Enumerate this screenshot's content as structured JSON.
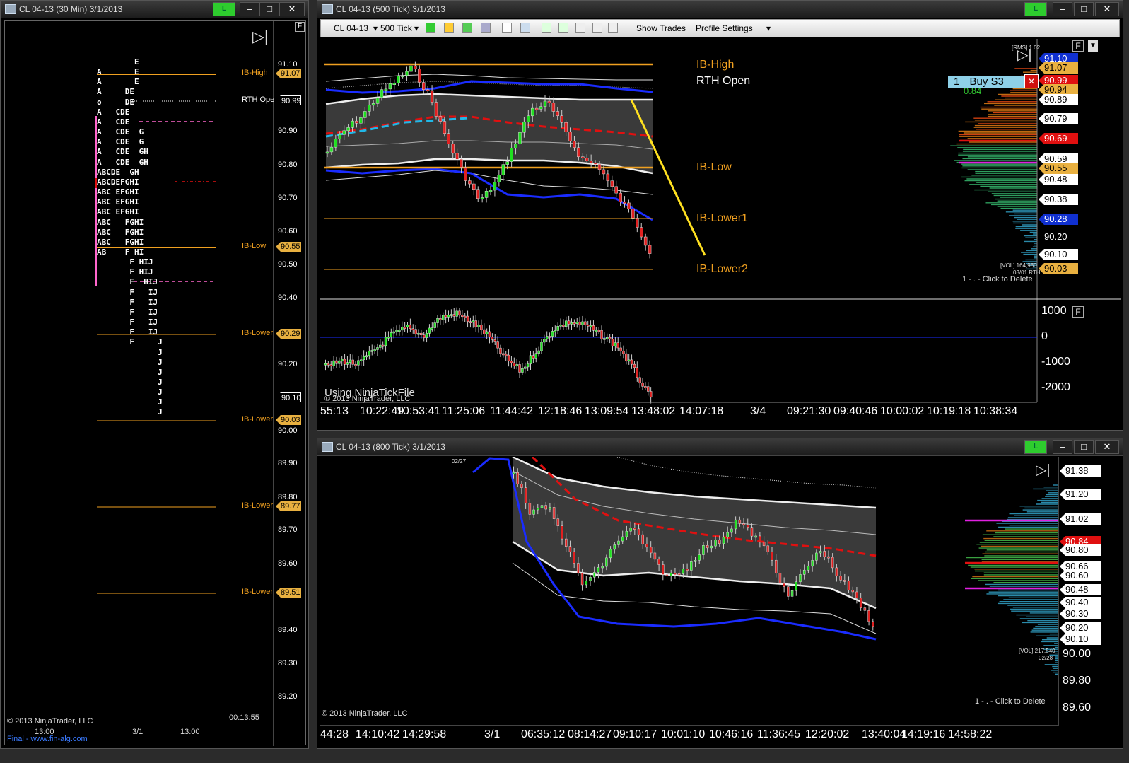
{
  "left": {
    "title": "CL 04-13 (30 Min)  3/1/2013",
    "level_labels": [
      {
        "text": "IB-High",
        "tag": "91.07",
        "color": "#f0a020"
      },
      {
        "text": "RTH Ope",
        "tag": "90.99",
        "color": "#ffffff"
      },
      {
        "text": "IB-Low",
        "tag": "90.55",
        "color": "#f0a020"
      },
      {
        "text": "IB-Lower",
        "tag": "90.29",
        "color": "#f0a020"
      },
      {
        "text": "IB-Lower",
        "tag": "90.03",
        "color": "#f0a020"
      },
      {
        "text": "IB-Lower",
        "tag": "89.77",
        "color": "#f0a020"
      },
      {
        "text": "IB-Lower",
        "tag": "89.51",
        "color": "#f0a020"
      }
    ],
    "price_labels": [
      "91.10",
      "90.90",
      "90.80",
      "90.70",
      "90.60",
      "90.50",
      "90.40",
      "90.20",
      "90.00",
      "89.90",
      "89.80",
      "89.70",
      "89.60",
      "89.40",
      "89.30",
      "89.20"
    ],
    "last_price_tag": "90.10",
    "tpo_rows": [
      "        E",
      "A       E",
      "A       E",
      "A     DE",
      "o     DE",
      "A   CDE",
      "A   CDE",
      "A   CDE  G",
      "A   CDE  G",
      "A   CDE  GH",
      "A   CDE  GH",
      "ABCDE  GH",
      "ABCDEFGHI",
      "ABC EFGHI",
      "ABC EFGHI",
      "ABC EFGHI",
      "ABC   FGHI",
      "ABC   FGHI",
      "ABC   FGHI",
      "AB    F HI",
      "       F HIJ",
      "       F HIJ",
      "       F  HIJ",
      "       F   IJ",
      "       F   IJ",
      "       F   IJ",
      "       F   IJ",
      "       F   IJ",
      "       F     J",
      "             J",
      "             J",
      "             J",
      "             J",
      "             J",
      "             J",
      "             J"
    ],
    "time_labels": [
      "13:00",
      "3/1",
      "13:00"
    ],
    "clock": "00:13:55",
    "copyright": "© 2013 NinjaTrader, LLC",
    "footer": "Final - www.fin-alg.com"
  },
  "top": {
    "title": "CL 04-13 (500 Tick)  3/1/2013",
    "toolbar": {
      "instrument": "CL 04-13",
      "interval": "500 Tick",
      "show_trades": "Show Trades",
      "profile_settings": "Profile Settings"
    },
    "annotations": [
      {
        "text": "IB-High",
        "color": "#f0a020"
      },
      {
        "text": "RTH Open",
        "color": "#ffffff"
      },
      {
        "text": "IB-Low",
        "color": "#f0a020"
      },
      {
        "text": "IB-Lower1",
        "color": "#f0a020"
      },
      {
        "text": "IB-Lower2",
        "color": "#f0a020"
      }
    ],
    "price_tags": [
      {
        "v": "91.10",
        "bg": "#1030d0",
        "fg": "#ffffff"
      },
      {
        "v": "91.07",
        "bg": "#e8b040",
        "fg": "#000000"
      },
      {
        "v": "90.99",
        "bg": "#e01010",
        "fg": "#ffffff"
      },
      {
        "v": "90.94",
        "bg": "#e8b040",
        "fg": "#000000"
      },
      {
        "v": "90.89",
        "bg": "#ffffff",
        "fg": "#000000"
      },
      {
        "v": "90.79",
        "bg": "#ffffff",
        "fg": "#000000"
      },
      {
        "v": "90.69",
        "bg": "#e01010",
        "fg": "#ffffff"
      },
      {
        "v": "90.59",
        "bg": "#ffffff",
        "fg": "#000000"
      },
      {
        "v": "90.55",
        "bg": "#e8b040",
        "fg": "#000000"
      },
      {
        "v": "90.48",
        "bg": "#ffffff",
        "fg": "#000000"
      },
      {
        "v": "90.38",
        "bg": "#ffffff",
        "fg": "#000000"
      },
      {
        "v": "90.28",
        "bg": "#1030d0",
        "fg": "#ffffff"
      },
      {
        "v": "90.20",
        "bg": "#000000",
        "fg": "#ffffff"
      },
      {
        "v": "90.10",
        "bg": "#ffffff",
        "fg": "#000000"
      },
      {
        "v": "90.03",
        "bg": "#e8b040",
        "fg": "#000000"
      }
    ],
    "order": {
      "qty": "1",
      "label": "Buy S3",
      "price": "0.84",
      "close": "×"
    },
    "vol_label": "[VOL] 164,980",
    "vol_date": "03/01 RTH",
    "rms_label": "[RMS] 1.02",
    "click_delete": "1 - . - Click to Delete",
    "osc_labels": [
      "1000",
      "0",
      "-1000",
      "-2000"
    ],
    "watermark": "Using NinjaTickFile",
    "copyright": "© 2013 NinjaTrader, LLC",
    "time_labels": [
      "55:13",
      "10:22:49",
      "10:53:41",
      "11:25:06",
      "11:44:42",
      "12:18:46",
      "13:09:54",
      "13:48:02",
      "14:07:18",
      "3/4",
      "09:21:30",
      "09:40:46",
      "10:00:02",
      "10:19:18",
      "10:38:34"
    ],
    "f_button": "F"
  },
  "bottom": {
    "title": "CL 04-13 (800 Tick)  3/1/2013",
    "price_tags": [
      {
        "v": "91.38",
        "bg": "#ffffff",
        "fg": "#000000"
      },
      {
        "v": "91.20",
        "bg": "#ffffff",
        "fg": "#000000"
      },
      {
        "v": "91.02",
        "bg": "#ffffff",
        "fg": "#000000"
      },
      {
        "v": "90.84",
        "bg": "#e01010",
        "fg": "#ffffff"
      },
      {
        "v": "90.80",
        "bg": "#ffffff",
        "fg": "#000000"
      },
      {
        "v": "90.66",
        "bg": "#ffffff",
        "fg": "#000000"
      },
      {
        "v": "90.60",
        "bg": "#ffffff",
        "fg": "#000000"
      },
      {
        "v": "90.48",
        "bg": "#ffffff",
        "fg": "#000000"
      },
      {
        "v": "90.40",
        "bg": "#ffffff",
        "fg": "#000000"
      },
      {
        "v": "90.30",
        "bg": "#ffffff",
        "fg": "#000000"
      },
      {
        "v": "90.20",
        "bg": "#ffffff",
        "fg": "#000000"
      },
      {
        "v": "90.10",
        "bg": "#ffffff",
        "fg": "#000000"
      }
    ],
    "axis_labels": [
      "90.00",
      "89.80",
      "89.60"
    ],
    "vol_label": "[VOL] 217,540",
    "vol_date": "02/28",
    "date_marker": "02/27",
    "click_delete": "1 - . - Click to Delete",
    "copyright": "© 2013 NinjaTrader, LLC",
    "time_labels": [
      "44:28",
      "14:10:42",
      "14:29:58",
      "3/1",
      "06:35:12",
      "08:14:27",
      "09:10:17",
      "10:01:10",
      "10:46:16",
      "11:36:45",
      "12:20:02",
      "13:40:04",
      "14:19:16",
      "14:58:22"
    ]
  },
  "window_buttons": {
    "lock": "L",
    "min": "–",
    "max": "□",
    "close": "✕"
  }
}
